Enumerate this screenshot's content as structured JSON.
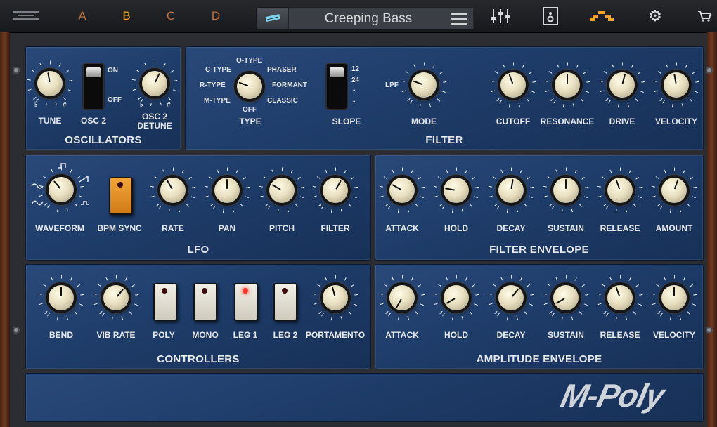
{
  "topbar": {
    "slots": [
      "A",
      "B",
      "C",
      "D"
    ],
    "active_slot": "B",
    "preset_name": "Creeping Bass",
    "icons": [
      "menu-lines-icon",
      "keyboard-icon",
      "hamburger-icon",
      "mixer-sliders-icon",
      "speaker-icon",
      "steps-icon",
      "gear-icon",
      "cart-icon"
    ]
  },
  "oscillators": {
    "title": "OSCILLATORS",
    "tune": "TUNE",
    "osc2": "OSC 2",
    "osc2_on": "ON",
    "osc2_off": "OFF",
    "osc2_detune": "OSC 2\nDETUNE",
    "flat": "♭",
    "sharp": "#"
  },
  "filter": {
    "title": "FILTER",
    "type": "TYPE",
    "type_options": [
      "O-TYPE",
      "C-TYPE",
      "PHASER",
      "R-TYPE",
      "FORMANT",
      "M-TYPE",
      "CLASSIC",
      "OFF"
    ],
    "slope": "SLOPE",
    "slope_options": [
      "12",
      "24",
      "-",
      "-"
    ],
    "mode": "MODE",
    "mode_option": "LPF",
    "knobs": [
      "CUTOFF",
      "RESONANCE",
      "DRIVE",
      "VELOCITY"
    ]
  },
  "lfo": {
    "title": "LFO",
    "waveform": "WAVEFORM",
    "bpm_sync": "BPM SYNC",
    "knobs": [
      "RATE",
      "PAN",
      "PITCH",
      "FILTER"
    ]
  },
  "filter_envelope": {
    "title": "FILTER ENVELOPE",
    "knobs": [
      "ATTACK",
      "HOLD",
      "DECAY",
      "SUSTAIN",
      "RELEASE",
      "AMOUNT"
    ]
  },
  "controllers": {
    "title": "CONTROLLERS",
    "bend": "BEND",
    "vib_rate": "VIB RATE",
    "buttons": [
      "POLY",
      "MONO",
      "LEG 1",
      "LEG 2"
    ],
    "active_button": "LEG 1",
    "portamento": "PORTAMENTO"
  },
  "amplitude_envelope": {
    "title": "AMPLITUDE ENVELOPE",
    "knobs": [
      "ATTACK",
      "HOLD",
      "DECAY",
      "SUSTAIN",
      "RELEASE",
      "VELOCITY"
    ]
  },
  "brand": {
    "logo": "M-Poly"
  },
  "colors": {
    "panel": "#1f3d6b",
    "accent": "#f2a030",
    "knob_cap": "#e7dfbf",
    "led_on": "#ff3a2a"
  }
}
